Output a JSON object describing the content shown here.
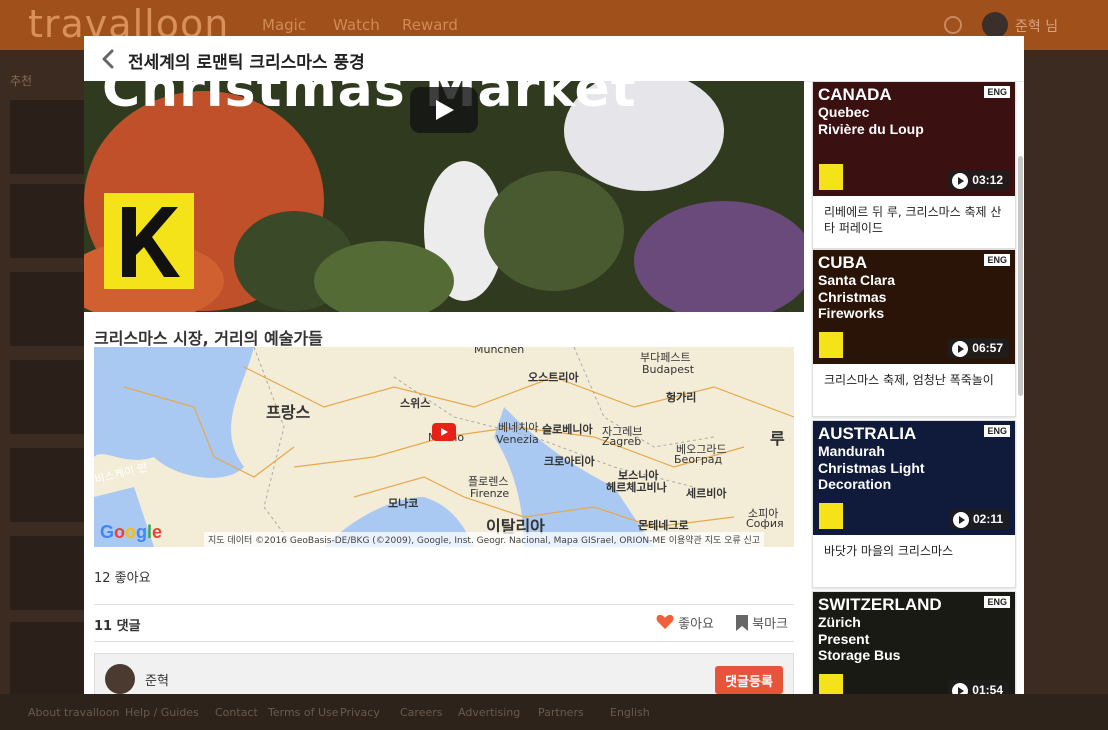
{
  "background": {
    "logo": "travalloon",
    "nav": [
      "Magic",
      "Watch",
      "Reward"
    ],
    "user": "준혁 님",
    "left_label": "추천",
    "footer": [
      "About travalloon",
      "Help / Guides",
      "Contact",
      "Terms of Use",
      "Privacy",
      "Careers",
      "Advertising",
      "Partners",
      "English"
    ]
  },
  "modal": {
    "title": "전세계의 로맨틱 크리스마스 풍경",
    "video": {
      "overlay_text": "Christmas Market"
    },
    "section_title": "크리스마스 시장, 거리의 예술가들",
    "map": {
      "labels": [
        {
          "text": "프랑스",
          "big": true
        },
        {
          "text": "스위스"
        },
        {
          "text": "Milano"
        },
        {
          "text": "베네치아"
        },
        {
          "text": "Venezia"
        },
        {
          "text": "오스트리아"
        },
        {
          "text": "München"
        },
        {
          "text": "부다페스트"
        },
        {
          "text": "Budapest"
        },
        {
          "text": "헝가리"
        },
        {
          "text": "슬로베니아"
        },
        {
          "text": "자그레브"
        },
        {
          "text": "Zagreb"
        },
        {
          "text": "크로아티아"
        },
        {
          "text": "베오그라드"
        },
        {
          "text": "Београд"
        },
        {
          "text": "보스니아"
        },
        {
          "text": "헤르체고비나"
        },
        {
          "text": "세르비아"
        },
        {
          "text": "플로렌스"
        },
        {
          "text": "Firenze"
        },
        {
          "text": "모나코"
        },
        {
          "text": "이탈리아",
          "big": true
        },
        {
          "text": "몬테네그로"
        },
        {
          "text": "소피아"
        },
        {
          "text": "София"
        },
        {
          "text": "루"
        },
        {
          "text": "비스케이 만"
        }
      ],
      "google": "Google",
      "attribution": "지도 데이터 ©2016 GeoBasis-DE/BKG (©2009), Google, Inst. Geogr. Nacional, Mapa GISrael, ORION-ME   이용약관   지도 오류 신고"
    },
    "likes_count": "12 좋아요",
    "comments_count": "11 댓글",
    "like_label": "좋아요",
    "bookmark_label": "북마크",
    "comment": {
      "user": "준혁",
      "submit_label": "댓글등록"
    }
  },
  "sidebar": {
    "cards": [
      {
        "country": "CANADA",
        "place": "Quebec",
        "event": "Rivière du Loup",
        "badge": "ENG",
        "duration": "03:12",
        "title": "리베에르 뒤 루, 크리스마스 축제 산타 퍼레이드",
        "color": "#3a1010"
      },
      {
        "country": "CUBA",
        "place": "Santa Clara",
        "event": "Christmas\nFireworks",
        "badge": "ENG",
        "duration": "06:57",
        "title": "크리스마스 축제, 엄청난 폭죽놀이",
        "color": "#2a1408"
      },
      {
        "country": "AUSTRALIA",
        "place": "Mandurah",
        "event": "Christmas Light\nDecoration",
        "badge": "ENG",
        "duration": "02:11",
        "title": "바닷가 마을의 크리스마스",
        "color": "#101a3a"
      },
      {
        "country": "SWITZERLAND",
        "place": "Zürich",
        "event": "Present\nStorage Bus",
        "badge": "ENG",
        "duration": "01:54",
        "title": "",
        "color": "#1a1a14"
      }
    ]
  },
  "colors": {
    "accent": "#e8543a",
    "k_yellow": "#f5e31a",
    "youtube_red": "#e62117"
  }
}
